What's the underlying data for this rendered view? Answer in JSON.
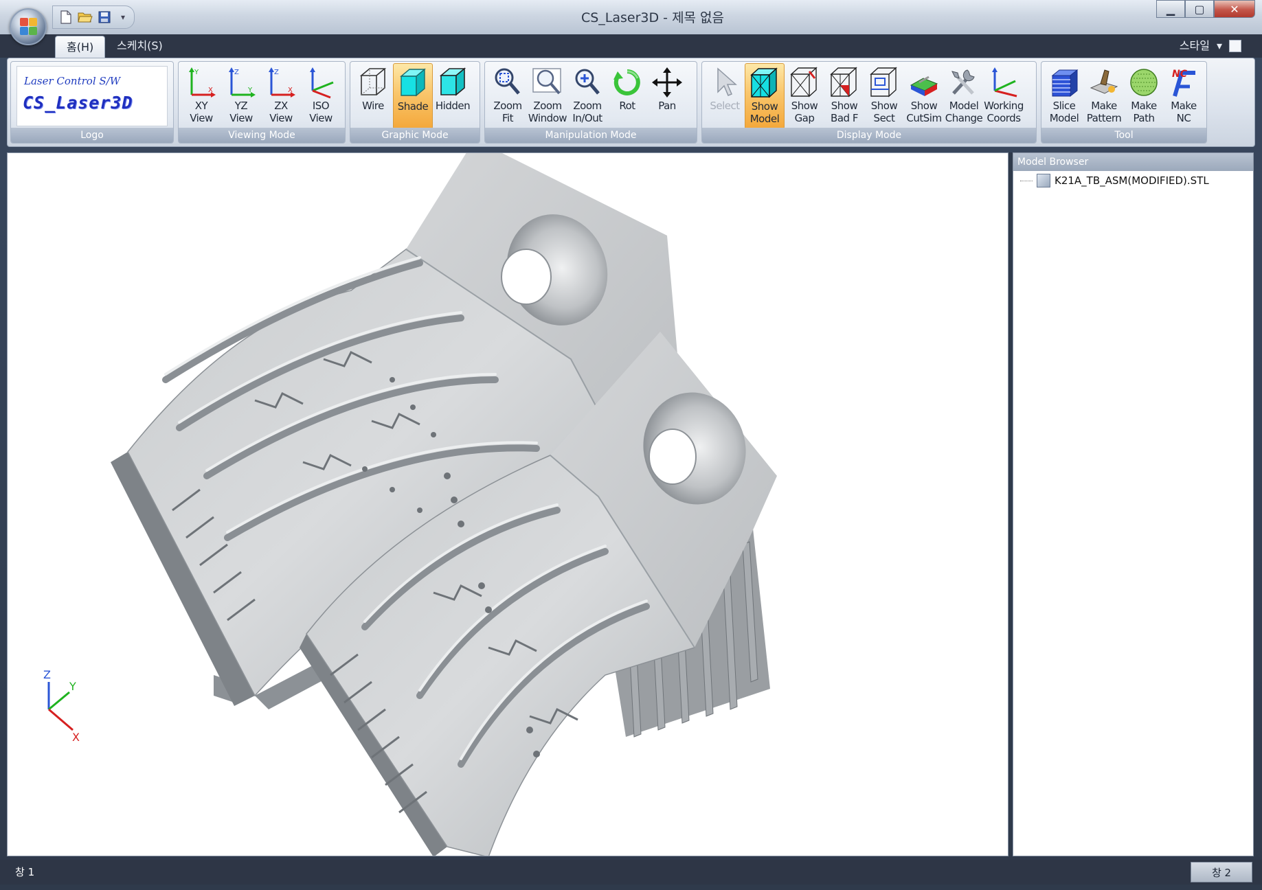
{
  "window": {
    "title": "CS_Laser3D - 제목 없음",
    "controls": {
      "minimize": "▁",
      "maximize": "▢",
      "close": "✕"
    }
  },
  "quick_access": [
    "new-icon",
    "open-icon",
    "save-icon"
  ],
  "tabs": [
    {
      "label": "홈(H)",
      "active": true
    },
    {
      "label": "스케치(S)",
      "active": false
    }
  ],
  "style_menu": {
    "label": "스타일",
    "arrow": "▾"
  },
  "logo": {
    "subtitle": "Laser Control S/W",
    "name": "CS_Laser3D"
  },
  "groups": {
    "logo": {
      "caption": "Logo"
    },
    "viewing": {
      "caption": "Viewing Mode",
      "buttons": [
        {
          "label": "XY\nView",
          "icon": "xy-view-icon"
        },
        {
          "label": "YZ\nView",
          "icon": "yz-view-icon"
        },
        {
          "label": "ZX\nView",
          "icon": "zx-view-icon"
        },
        {
          "label": "ISO\nView",
          "icon": "iso-view-icon"
        }
      ]
    },
    "graphic": {
      "caption": "Graphic Mode",
      "buttons": [
        {
          "label": "Wire",
          "icon": "wireframe-cube-icon"
        },
        {
          "label": "Shade",
          "icon": "shaded-cube-icon",
          "active": true
        },
        {
          "label": "Hidden",
          "icon": "hidden-cube-icon"
        }
      ]
    },
    "manipulation": {
      "caption": "Manipulation Mode",
      "buttons": [
        {
          "label": "Zoom\nFit",
          "icon": "zoom-fit-icon"
        },
        {
          "label": "Zoom\nWindow",
          "icon": "zoom-window-icon"
        },
        {
          "label": "Zoom\nIn/Out",
          "icon": "zoom-in-out-icon"
        },
        {
          "label": "Rot",
          "icon": "rotate-icon"
        },
        {
          "label": "Pan",
          "icon": "pan-icon"
        }
      ]
    },
    "display": {
      "caption": "Display Mode",
      "buttons": [
        {
          "label": "Select",
          "icon": "select-arrow-icon",
          "disabled": true
        },
        {
          "label": "Show\nModel",
          "icon": "show-model-icon",
          "active": true
        },
        {
          "label": "Show\nGap",
          "icon": "show-gap-icon"
        },
        {
          "label": "Show\nBad F",
          "icon": "show-bad-face-icon"
        },
        {
          "label": "Show\nSect",
          "icon": "show-section-icon"
        },
        {
          "label": "Show\nCutSim",
          "icon": "show-cutsim-icon"
        },
        {
          "label": "Model\nChange",
          "icon": "model-change-icon"
        },
        {
          "label": "Working\nCoords",
          "icon": "working-coords-icon"
        }
      ]
    },
    "tool": {
      "caption": "Tool",
      "buttons": [
        {
          "label": "Slice\nModel",
          "icon": "slice-model-icon"
        },
        {
          "label": "Make\nPattern",
          "icon": "make-pattern-icon"
        },
        {
          "label": "Make\nPath",
          "icon": "make-path-icon"
        },
        {
          "label": "Make\nNC",
          "icon": "make-nc-icon"
        }
      ]
    }
  },
  "viewport": {
    "axes": {
      "z": "Z",
      "y": "Y",
      "x": "X"
    },
    "colors": {
      "model_light": "#e6e8ea",
      "model_mid": "#c3c6c9",
      "model_dark": "#8c9196",
      "model_darkest": "#5f6569"
    }
  },
  "model_browser": {
    "title": "Model Browser",
    "items": [
      {
        "label": "K21A_TB_ASM(MODIFIED).STL",
        "icon": "stl-file-icon"
      }
    ]
  },
  "statusbar": {
    "left": "창 1",
    "right": "창 2"
  }
}
